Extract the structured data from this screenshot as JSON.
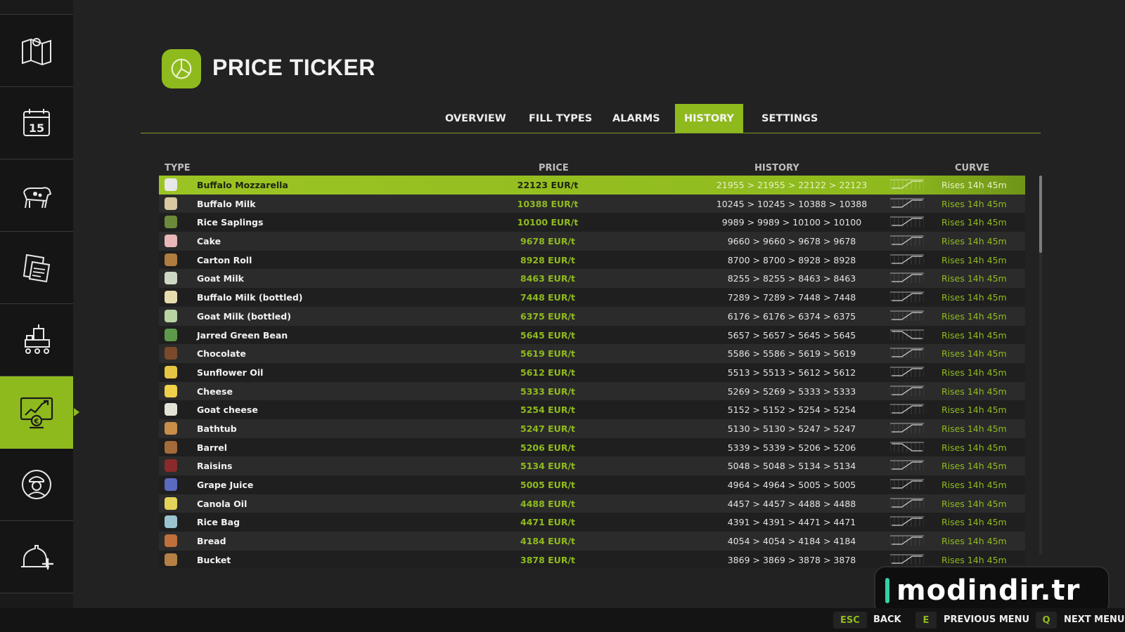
{
  "header": {
    "title": "PRICE TICKER"
  },
  "tabs": [
    {
      "label": "OVERVIEW"
    },
    {
      "label": "FILL TYPES"
    },
    {
      "label": "ALARMS"
    },
    {
      "label": "HISTORY"
    },
    {
      "label": "SETTINGS"
    }
  ],
  "active_tab": "HISTORY",
  "sidebar": {
    "items": [
      {
        "icon": "map-icon"
      },
      {
        "icon": "calendar-icon",
        "label": "15"
      },
      {
        "icon": "animals-icon"
      },
      {
        "icon": "contracts-icon"
      },
      {
        "icon": "production-icon"
      },
      {
        "icon": "price-chart-icon"
      },
      {
        "icon": "workers-icon"
      },
      {
        "icon": "help-icon"
      }
    ],
    "active_index": 5
  },
  "table": {
    "headers": {
      "type": "TYPE",
      "price": "PRICE",
      "history": "HISTORY",
      "curve": "CURVE"
    },
    "rows": [
      {
        "name": "Buffalo Mozzarella",
        "price": "22123 EUR/t",
        "history": "21955 > 21955 > 22122 > 22123",
        "curve": "Rises 14h 45m",
        "color": "#e8e8e8",
        "selected": true
      },
      {
        "name": "Buffalo Milk",
        "price": "10388 EUR/t",
        "history": "10245 > 10245 > 10388 > 10388",
        "curve": "Rises 14h 45m",
        "color": "#d9c8a0"
      },
      {
        "name": "Rice Saplings",
        "price": "10100 EUR/t",
        "history": "9989 > 9989 > 10100 > 10100",
        "curve": "Rises 14h 45m",
        "color": "#6c8a3a"
      },
      {
        "name": "Cake",
        "price": "9678 EUR/t",
        "history": "9660 > 9660 > 9678 > 9678",
        "curve": "Rises 14h 45m",
        "color": "#e9b7b7"
      },
      {
        "name": "Carton Roll",
        "price": "8928 EUR/t",
        "history": "8700 > 8700 > 8928 > 8928",
        "curve": "Rises 14h 45m",
        "color": "#b07d3e"
      },
      {
        "name": "Goat Milk",
        "price": "8463 EUR/t",
        "history": "8255 > 8255 > 8463 > 8463",
        "curve": "Rises 14h 45m",
        "color": "#cfd8c4"
      },
      {
        "name": "Buffalo Milk (bottled)",
        "price": "7448 EUR/t",
        "history": "7289 > 7289 > 7448 > 7448",
        "curve": "Rises 14h 45m",
        "color": "#e7dcae"
      },
      {
        "name": "Goat Milk (bottled)",
        "price": "6375 EUR/t",
        "history": "6176 > 6176 > 6374 > 6375",
        "curve": "Rises 14h 45m",
        "color": "#b9d6a2"
      },
      {
        "name": "Jarred Green Bean",
        "price": "5645 EUR/t",
        "history": "5657 > 5657 > 5645 > 5645",
        "curve": "Rises 14h 45m",
        "color": "#5c9a4a"
      },
      {
        "name": "Chocolate",
        "price": "5619 EUR/t",
        "history": "5586 > 5586 > 5619 > 5619",
        "curve": "Rises 14h 45m",
        "color": "#7a4a2a"
      },
      {
        "name": "Sunflower Oil",
        "price": "5612 EUR/t",
        "history": "5513 > 5513 > 5612 > 5612",
        "curve": "Rises 14h 45m",
        "color": "#e6c542"
      },
      {
        "name": "Cheese",
        "price": "5333 EUR/t",
        "history": "5269 > 5269 > 5333 > 5333",
        "curve": "Rises 14h 45m",
        "color": "#f0cf4a"
      },
      {
        "name": "Goat cheese",
        "price": "5254 EUR/t",
        "history": "5152 > 5152 > 5254 > 5254",
        "curve": "Rises 14h 45m",
        "color": "#e2e2d6"
      },
      {
        "name": "Bathtub",
        "price": "5247 EUR/t",
        "history": "5130 > 5130 > 5247 > 5247",
        "curve": "Rises 14h 45m",
        "color": "#c98e4a"
      },
      {
        "name": "Barrel",
        "price": "5206 EUR/t",
        "history": "5339 > 5339 > 5206 > 5206",
        "curve": "Rises 14h 45m",
        "color": "#a36a3a"
      },
      {
        "name": "Raisins",
        "price": "5134 EUR/t",
        "history": "5048 > 5048 > 5134 > 5134",
        "curve": "Rises 14h 45m",
        "color": "#8a2a2a"
      },
      {
        "name": "Grape Juice",
        "price": "5005 EUR/t",
        "history": "4964 > 4964 > 5005 > 5005",
        "curve": "Rises 14h 45m",
        "color": "#5a6abf"
      },
      {
        "name": "Canola Oil",
        "price": "4488 EUR/t",
        "history": "4457 > 4457 > 4488 > 4488",
        "curve": "Rises 14h 45m",
        "color": "#e3d35a"
      },
      {
        "name": "Rice Bag",
        "price": "4471 EUR/t",
        "history": "4391 > 4391 > 4471 > 4471",
        "curve": "Rises 14h 45m",
        "color": "#9bc4d0"
      },
      {
        "name": "Bread",
        "price": "4184 EUR/t",
        "history": "4054 > 4054 > 4184 > 4184",
        "curve": "Rises 14h 45m",
        "color": "#c0703a"
      },
      {
        "name": "Bucket",
        "price": "3878 EUR/t",
        "history": "3869 > 3869 > 3878 > 3878",
        "curve": "Rises 14h 45m",
        "color": "#b57f45"
      }
    ]
  },
  "watermark": {
    "text": "modindir.tr"
  },
  "bottom_bar": {
    "back": {
      "key": "ESC",
      "label": "BACK"
    },
    "prev": {
      "key": "E",
      "label": "PREVIOUS MENU"
    },
    "next": {
      "key": "Q",
      "label": "NEXT MENU"
    }
  },
  "colors": {
    "accent": "#8fba1e",
    "background": "#222222",
    "sidebar": "#151515"
  }
}
